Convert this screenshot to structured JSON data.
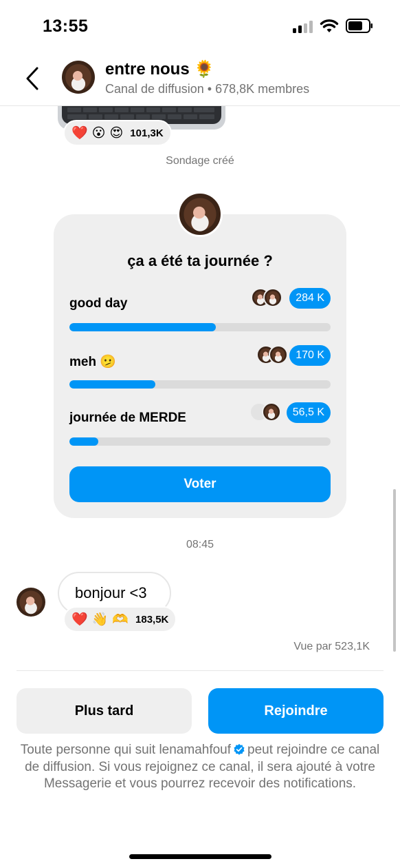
{
  "status_bar": {
    "time": "13:55"
  },
  "header": {
    "title": "entre nous 🌻",
    "subtitle": "Canal de diffusion • 678,8K membres"
  },
  "previous_message": {
    "reactions": [
      "❤️",
      "😮",
      "😍"
    ],
    "reaction_count": "101,3K"
  },
  "poll_created_text": "Sondage créé",
  "poll": {
    "question": "ça a été ta journée ?",
    "options": [
      {
        "label": "good day",
        "count": "284 K",
        "fraction": 0.56
      },
      {
        "label": "meh 🫤",
        "count": "170 K",
        "fraction": 0.33
      },
      {
        "label": "journée de MERDE",
        "count": "56,5 K",
        "fraction": 0.11
      }
    ],
    "vote_label": "Voter"
  },
  "timestamp": "08:45",
  "message": {
    "text": "bonjour <3",
    "reactions": [
      "❤️",
      "👋",
      "🫶"
    ],
    "reaction_count": "183,5K",
    "seen_by": "Vue par 523,1K"
  },
  "actions": {
    "later_label": "Plus tard",
    "join_label": "Rejoindre"
  },
  "footer": {
    "text_before": "Toute personne qui suit lenamahfouf",
    "text_after": "peut rejoindre ce canal de diffusion. Si vous rejoignez ce canal, il sera ajouté à votre Messagerie et vous pourrez recevoir des notifications."
  },
  "colors": {
    "accent": "#0095f6",
    "card_bg": "#efefef",
    "secondary_text": "#737373"
  },
  "icons": {
    "back": "chevron-left-icon",
    "signal": "cellular-signal-icon",
    "wifi": "wifi-icon",
    "battery": "battery-icon",
    "verified": "verified-badge-icon"
  }
}
